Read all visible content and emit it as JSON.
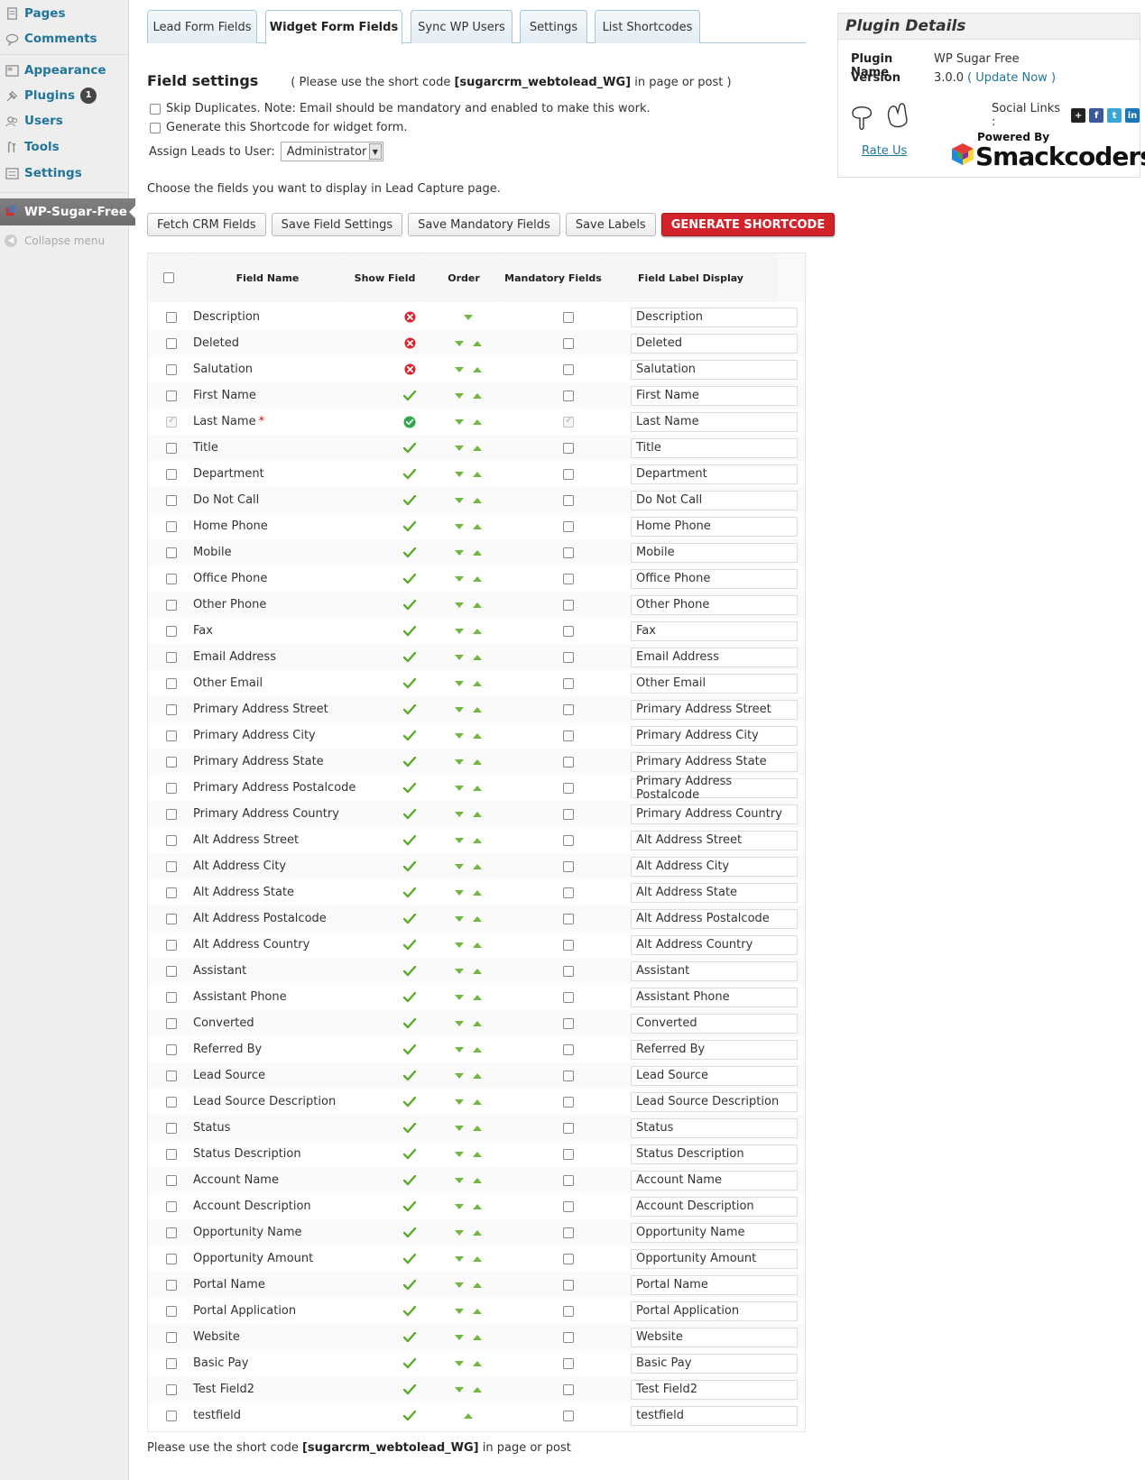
{
  "sidebar": {
    "items": [
      {
        "label": "Pages",
        "icon": "pages-icon"
      },
      {
        "label": "Comments",
        "icon": "comments-icon"
      },
      {
        "label": "Appearance",
        "icon": "appearance-icon"
      },
      {
        "label": "Plugins",
        "icon": "plugins-icon",
        "badge": "1"
      },
      {
        "label": "Users",
        "icon": "users-icon"
      },
      {
        "label": "Tools",
        "icon": "tools-icon"
      },
      {
        "label": "Settings",
        "icon": "settings-icon"
      }
    ],
    "current": "WP-Sugar-Free",
    "collapse": "Collapse menu"
  },
  "tabs": [
    "Lead Form Fields",
    "Widget Form Fields",
    "Sync WP Users",
    "Settings",
    "List Shortcodes"
  ],
  "active_tab": "Widget Form Fields",
  "field_settings": {
    "title": "Field settings",
    "note_prefix": "( Please use the short code ",
    "shortcode": "[sugarcrm_webtolead_WG]",
    "note_suffix": " in page or post )",
    "skip_duplicates": "Skip Duplicates. Note: Email should be mandatory and enabled to make this work.",
    "generate_shortcode": "Generate this Shortcode for widget form.",
    "assign_label": "Assign Leads to User:",
    "assign_value": "Administrator",
    "choose_text": "Choose the fields you want to display in Lead Capture page."
  },
  "buttons": {
    "fetch": "Fetch CRM Fields",
    "save_fields": "Save Field Settings",
    "save_mandatory": "Save Mandatory Fields",
    "save_labels": "Save Labels",
    "generate": "GENERATE SHORTCODE"
  },
  "table": {
    "headers": {
      "name": "Field Name",
      "show": "Show Field",
      "order": "Order",
      "mandatory": "Mandatory Fields",
      "label": "Field Label Display"
    },
    "rows": [
      {
        "name": "Description",
        "show": "hidden",
        "order": "down",
        "mandatory": false,
        "label": "Description"
      },
      {
        "name": "Deleted",
        "show": "hidden",
        "order": "both",
        "mandatory": false,
        "label": "Deleted"
      },
      {
        "name": "Salutation",
        "show": "hidden",
        "order": "both",
        "mandatory": false,
        "label": "Salutation"
      },
      {
        "name": "First Name",
        "show": "shown",
        "order": "both",
        "mandatory": false,
        "label": "First Name"
      },
      {
        "name": "Last Name",
        "show": "required",
        "order": "both",
        "mandatory": true,
        "required": true,
        "label": "Last Name"
      },
      {
        "name": "Title",
        "show": "shown",
        "order": "both",
        "mandatory": false,
        "label": "Title"
      },
      {
        "name": "Department",
        "show": "shown",
        "order": "both",
        "mandatory": false,
        "label": "Department"
      },
      {
        "name": "Do Not Call",
        "show": "shown",
        "order": "both",
        "mandatory": false,
        "label": "Do Not Call"
      },
      {
        "name": "Home Phone",
        "show": "shown",
        "order": "both",
        "mandatory": false,
        "label": "Home Phone"
      },
      {
        "name": "Mobile",
        "show": "shown",
        "order": "both",
        "mandatory": false,
        "label": "Mobile"
      },
      {
        "name": "Office Phone",
        "show": "shown",
        "order": "both",
        "mandatory": false,
        "label": "Office Phone"
      },
      {
        "name": "Other Phone",
        "show": "shown",
        "order": "both",
        "mandatory": false,
        "label": "Other Phone"
      },
      {
        "name": "Fax",
        "show": "shown",
        "order": "both",
        "mandatory": false,
        "label": "Fax"
      },
      {
        "name": "Email Address",
        "show": "shown",
        "order": "both",
        "mandatory": false,
        "label": "Email Address"
      },
      {
        "name": "Other Email",
        "show": "shown",
        "order": "both",
        "mandatory": false,
        "label": "Other Email"
      },
      {
        "name": "Primary Address Street",
        "show": "shown",
        "order": "both",
        "mandatory": false,
        "label": "Primary Address Street"
      },
      {
        "name": "Primary Address City",
        "show": "shown",
        "order": "both",
        "mandatory": false,
        "label": "Primary Address City"
      },
      {
        "name": "Primary Address State",
        "show": "shown",
        "order": "both",
        "mandatory": false,
        "label": "Primary Address State"
      },
      {
        "name": "Primary Address Postalcode",
        "show": "shown",
        "order": "both",
        "mandatory": false,
        "label": "Primary Address Postalcode"
      },
      {
        "name": "Primary Address Country",
        "show": "shown",
        "order": "both",
        "mandatory": false,
        "label": "Primary Address Country"
      },
      {
        "name": "Alt Address Street",
        "show": "shown",
        "order": "both",
        "mandatory": false,
        "label": "Alt Address Street"
      },
      {
        "name": "Alt Address City",
        "show": "shown",
        "order": "both",
        "mandatory": false,
        "label": "Alt Address City"
      },
      {
        "name": "Alt Address State",
        "show": "shown",
        "order": "both",
        "mandatory": false,
        "label": "Alt Address State"
      },
      {
        "name": "Alt Address Postalcode",
        "show": "shown",
        "order": "both",
        "mandatory": false,
        "label": "Alt Address Postalcode"
      },
      {
        "name": "Alt Address Country",
        "show": "shown",
        "order": "both",
        "mandatory": false,
        "label": "Alt Address Country"
      },
      {
        "name": "Assistant",
        "show": "shown",
        "order": "both",
        "mandatory": false,
        "label": "Assistant"
      },
      {
        "name": "Assistant Phone",
        "show": "shown",
        "order": "both",
        "mandatory": false,
        "label": "Assistant Phone"
      },
      {
        "name": "Converted",
        "show": "shown",
        "order": "both",
        "mandatory": false,
        "label": "Converted"
      },
      {
        "name": "Referred By",
        "show": "shown",
        "order": "both",
        "mandatory": false,
        "label": "Referred By"
      },
      {
        "name": "Lead Source",
        "show": "shown",
        "order": "both",
        "mandatory": false,
        "label": "Lead Source"
      },
      {
        "name": "Lead Source Description",
        "show": "shown",
        "order": "both",
        "mandatory": false,
        "label": "Lead Source Description"
      },
      {
        "name": "Status",
        "show": "shown",
        "order": "both",
        "mandatory": false,
        "label": "Status"
      },
      {
        "name": "Status Description",
        "show": "shown",
        "order": "both",
        "mandatory": false,
        "label": "Status Description"
      },
      {
        "name": "Account Name",
        "show": "shown",
        "order": "both",
        "mandatory": false,
        "label": "Account Name"
      },
      {
        "name": "Account Description",
        "show": "shown",
        "order": "both",
        "mandatory": false,
        "label": "Account Description"
      },
      {
        "name": "Opportunity Name",
        "show": "shown",
        "order": "both",
        "mandatory": false,
        "label": "Opportunity Name"
      },
      {
        "name": "Opportunity Amount",
        "show": "shown",
        "order": "both",
        "mandatory": false,
        "label": "Opportunity Amount"
      },
      {
        "name": "Portal Name",
        "show": "shown",
        "order": "both",
        "mandatory": false,
        "label": "Portal Name"
      },
      {
        "name": "Portal Application",
        "show": "shown",
        "order": "both",
        "mandatory": false,
        "label": "Portal Application"
      },
      {
        "name": "Website",
        "show": "shown",
        "order": "both",
        "mandatory": false,
        "label": "Website"
      },
      {
        "name": "Basic Pay",
        "show": "shown",
        "order": "both",
        "mandatory": false,
        "label": "Basic Pay"
      },
      {
        "name": "Test Field2",
        "show": "shown",
        "order": "both",
        "mandatory": false,
        "label": "Test Field2"
      },
      {
        "name": "testfield",
        "show": "shown",
        "order": "up",
        "mandatory": false,
        "label": "testfield"
      }
    ]
  },
  "footer": {
    "prefix": "Please use the short code ",
    "shortcode": "[sugarcrm_webtolead_WG]",
    "suffix": " in page or post"
  },
  "plugin_details": {
    "title": "Plugin Details",
    "name_key": "Plugin Name",
    "name_value": "WP Sugar Free",
    "version_key": "Version",
    "version_value": "3.0.0",
    "update_link": "( Update Now )",
    "social_label": "Social Links :",
    "rate_us": "Rate Us",
    "powered_by": "Powered By",
    "brand": "Smackcoders"
  },
  "colors": {
    "link": "#21759b",
    "generate_button": "#d2232a",
    "check_green": "#5aab2b",
    "hidden_red": "#d9232e"
  }
}
